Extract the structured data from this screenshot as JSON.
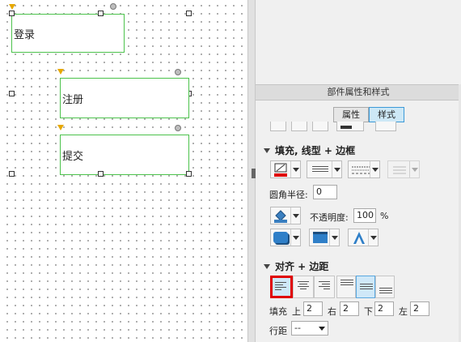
{
  "canvas": {
    "widgets": [
      {
        "label": "登录"
      },
      {
        "label": "注册"
      },
      {
        "label": "提交"
      }
    ]
  },
  "inspector": {
    "title": "部件属性和样式",
    "tabs": [
      {
        "label": "属性",
        "active": false
      },
      {
        "label": "样式",
        "active": true
      }
    ],
    "fill_section": {
      "title": "填充, 线型 + 边框",
      "corner_radius_label": "圆角半径:",
      "corner_radius_value": "0",
      "opacity_label": "不透明度:",
      "opacity_value": "100",
      "opacity_unit": "%"
    },
    "align_section": {
      "title": "对齐 + 边距",
      "padding_label": "填充",
      "top_label": "上",
      "top_value": "2",
      "right_label": "右",
      "right_value": "2",
      "bottom_label": "下",
      "bottom_value": "2",
      "left_label": "左",
      "left_value": "2",
      "line_spacing_label": "行距",
      "line_spacing_value": "--"
    }
  },
  "colors": {
    "widget_border": "#4cc24c",
    "selected_tab": "#cde8f6",
    "highlight": "#e00000"
  }
}
